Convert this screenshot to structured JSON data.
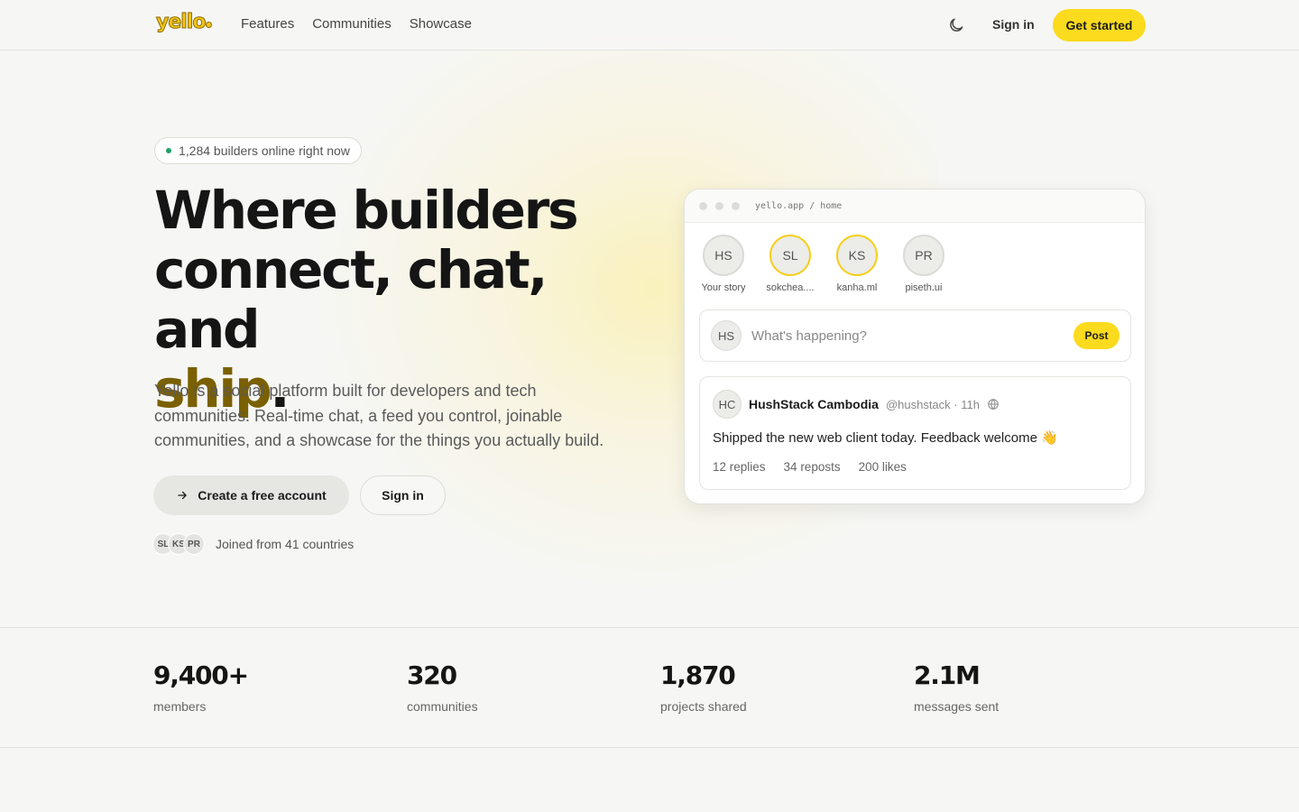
{
  "nav": {
    "logo": "yello",
    "links": [
      "Features",
      "Communities",
      "Showcase"
    ],
    "theme_icon": "moon-icon",
    "signin": "Sign in",
    "cta": "Get started"
  },
  "hero": {
    "online_pill": "1,284 builders online right now",
    "headline_line1": "Where builders",
    "headline_line2": "connect, chat, and",
    "headline_accent": "ship",
    "headline_end": ".",
    "subtitle": "Yello is a social platform built for developers and tech communities. Real-time chat, a feed you control, joinable communities, and a showcase for the things you actually build.",
    "primary_button": "Create a free account",
    "secondary_button": "Sign in",
    "joined_avatars": [
      "SL",
      "KS",
      "PR"
    ],
    "joined_text": "Joined from 41 countries"
  },
  "app_preview": {
    "url": "yello.app / home",
    "stories": [
      {
        "initials": "HS",
        "name": "Your story",
        "ring": false
      },
      {
        "initials": "SL",
        "name": "sokchea....",
        "ring": true
      },
      {
        "initials": "KS",
        "name": "kanha.ml",
        "ring": true
      },
      {
        "initials": "PR",
        "name": "piseth.ui",
        "ring": false
      }
    ],
    "composer": {
      "avatar": "HS",
      "placeholder": "What's happening?",
      "post_button": "Post"
    },
    "post": {
      "avatar": "HC",
      "author": "HushStack Cambodia",
      "meta": "@hushstack · 11h",
      "body": "Shipped the new web client today. Feedback welcome 👋",
      "replies": "12 replies",
      "reposts": "34 reposts",
      "likes": "200 likes"
    }
  },
  "stats": [
    {
      "value": "9,400+",
      "label": "members"
    },
    {
      "value": "320",
      "label": "communities"
    },
    {
      "value": "1,870",
      "label": "projects shared"
    },
    {
      "value": "2.1M",
      "label": "messages sent"
    }
  ],
  "colors": {
    "accent_yellow": "#fadb1e",
    "headline_accent": "#7a6000",
    "online_dot": "#22a06b"
  }
}
